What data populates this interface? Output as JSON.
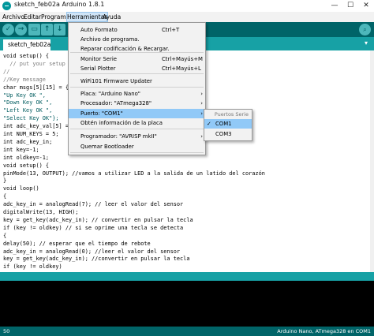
{
  "window": {
    "title": "sketch_feb02a Arduino 1.8.1",
    "min": "—",
    "max": "☐",
    "close": "✕"
  },
  "menubar": [
    "Archivo",
    "Editar",
    "Programa",
    "Herramientas",
    "Ayuda"
  ],
  "tab": {
    "label": "sketch_feb02a §"
  },
  "code": [
    {
      "t": "void setup() {",
      "c": "#000000"
    },
    {
      "t": "  // put your setup",
      "c": "#7e7e7e"
    },
    {
      "t": "//",
      "c": "#7e7e7e"
    },
    {
      "t": "//Key message",
      "c": "#7e7e7e"
    },
    {
      "t": "char msgs[5][15] = {",
      "c": "#000000"
    },
    {
      "t": "\"Up Key OK \",",
      "c": "#005c5f"
    },
    {
      "t": "\"Down Key OK \",",
      "c": "#005c5f"
    },
    {
      "t": "\"Left Key OK \",",
      "c": "#005c5f"
    },
    {
      "t": "\"Select Key OK\"};",
      "c": "#005c5f"
    },
    {
      "t": "int adc_key_val[5] =",
      "c": "#000000"
    },
    {
      "t": "int NUM_KEYS = 5;",
      "c": "#000000"
    },
    {
      "t": "int adc_key_in;",
      "c": "#000000"
    },
    {
      "t": "int key=-1;",
      "c": "#000000"
    },
    {
      "t": "int oldkey=-1;",
      "c": "#000000"
    },
    {
      "t": "void setup() {",
      "c": "#000000"
    },
    {
      "t": "pinMode(13, OUTPUT); //vamos a utilizar LED a la salida de un latido del corazón",
      "c": "#000000"
    },
    {
      "t": "}",
      "c": "#000000"
    },
    {
      "t": "void loop()",
      "c": "#000000"
    },
    {
      "t": "{",
      "c": "#000000"
    },
    {
      "t": "adc_key_in = analogRead(7); // leer el valor del sensor",
      "c": "#000000"
    },
    {
      "t": "digitalWrite(13, HIGH);",
      "c": "#000000"
    },
    {
      "t": "key = get_key(adc_key_in); // convertir en pulsar la tecla",
      "c": "#000000"
    },
    {
      "t": "if (key != oldkey) // si se oprime una tecla se detecta",
      "c": "#000000"
    },
    {
      "t": "{",
      "c": "#000000"
    },
    {
      "t": "delay(50); // esperar que el tiempo de rebote",
      "c": "#000000"
    },
    {
      "t": "adc_key_in = analogRead(0); //leer el valor del sensor",
      "c": "#000000"
    },
    {
      "t": "key = get_key(adc_key_in); //convertir en pulsar la tecla",
      "c": "#000000"
    },
    {
      "t": "if (key != oldkey)",
      "c": "#000000"
    }
  ],
  "dropdown": [
    {
      "label": "Auto Formato",
      "shortcut": "Ctrl+T"
    },
    {
      "label": "Archivo de programa.",
      "shortcut": ""
    },
    {
      "label": "Reparar codificación & Recargar.",
      "shortcut": ""
    },
    {
      "label": "Monitor Serie",
      "shortcut": "Ctrl+Mayús+M"
    },
    {
      "label": "Serial Plotter",
      "shortcut": "Ctrl+Mayús+L"
    },
    {
      "label": "WiFi101 Firmware Updater",
      "shortcut": ""
    },
    {
      "label": "Placa: \"Arduino Nano\"",
      "arrow": "›"
    },
    {
      "label": "Procesador: \"ATmega328\"",
      "arrow": "›"
    },
    {
      "label": "Puerto: \"COM1\"",
      "arrow": "›"
    },
    {
      "label": "Obtén información de la placa",
      "shortcut": ""
    },
    {
      "label": "Programador: \"AVRISP mkII\"",
      "arrow": "›"
    },
    {
      "label": "Quemar Bootloader",
      "shortcut": ""
    }
  ],
  "submenu": {
    "header": "Puertos Serie",
    "items": [
      {
        "label": "COM1",
        "checked": "✓"
      },
      {
        "label": "COM3",
        "checked": ""
      }
    ]
  },
  "status": {
    "line": "50",
    "board": "Arduino Nano, ATmega328 en COM1"
  },
  "colors": {
    "teal_dark": "#006468",
    "teal": "#17a1a5",
    "highlight": "#91c9f7"
  }
}
